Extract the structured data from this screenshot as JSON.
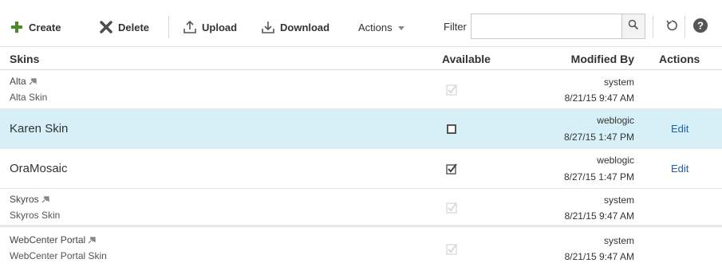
{
  "toolbar": {
    "create_label": "Create",
    "delete_label": "Delete",
    "upload_label": "Upload",
    "download_label": "Download",
    "actions_label": "Actions",
    "filter_label": "Filter",
    "filter_value": "",
    "filter_placeholder": ""
  },
  "table": {
    "headers": {
      "skins": "Skins",
      "available": "Available",
      "modified_by": "Modified By",
      "actions": "Actions"
    },
    "rows": [
      {
        "name": "Alta",
        "subtitle": "Alta Skin",
        "available": "checked-disabled",
        "modified_by": "system",
        "modified_date": "8/21/15 9:47 AM",
        "action": ""
      },
      {
        "name": "Karen Skin",
        "subtitle": "",
        "available": "unchecked",
        "modified_by": "weblogic",
        "modified_date": "8/27/15 1:47 PM",
        "action": "Edit",
        "selected": true
      },
      {
        "name": "OraMosaic",
        "subtitle": "",
        "available": "checked",
        "modified_by": "weblogic",
        "modified_date": "8/27/15 1:47 PM",
        "action": "Edit"
      },
      {
        "name": "Skyros",
        "subtitle": "Skyros Skin",
        "available": "checked-disabled",
        "modified_by": "system",
        "modified_date": "8/21/15 9:47 AM",
        "action": ""
      },
      {
        "name": "WebCenter Portal",
        "subtitle": "WebCenter Portal Skin",
        "available": "checked-disabled",
        "modified_by": "system",
        "modified_date": "8/21/15 9:47 AM",
        "action": ""
      }
    ]
  },
  "colors": {
    "selected_row": "#d7f0f7",
    "link": "#1f5fa8",
    "create_icon": "#4a8a2a"
  }
}
